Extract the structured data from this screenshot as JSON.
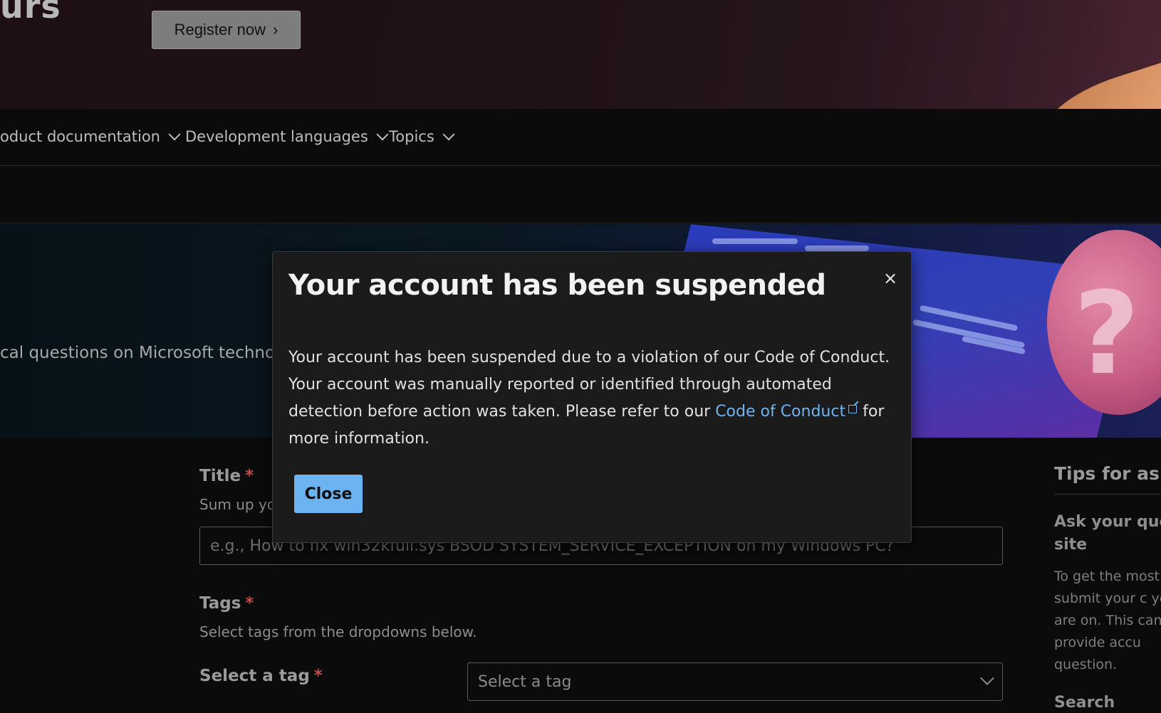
{
  "promo": {
    "title_fragment": "urs",
    "register_label": "Register now",
    "register_chevron": "›"
  },
  "nav": {
    "items": [
      {
        "label": "oduct documentation"
      },
      {
        "label": "Development languages"
      },
      {
        "label": "Topics"
      }
    ]
  },
  "hero": {
    "text_fragment": "cal questions on Microsoft technolog"
  },
  "form": {
    "title_label": "Title",
    "title_help": "Sum up yo",
    "title_placeholder": "e.g., How to fix win32kfull.sys BSOD SYSTEM_SERVICE_EXCEPTION on my Windows PC?",
    "required_marker": "*",
    "tags_label": "Tags",
    "tags_help": "Select tags from the dropdowns below.",
    "select_tag_label": "Select a tag",
    "select_tag_value": "Select a tag"
  },
  "sidebar": {
    "tips_title": "Tips for aski",
    "ask_heading": "Ask your ques site",
    "ask_text": "To get the most to submit your c you are on. This can provide accu question.",
    "search_heading": "Search"
  },
  "modal": {
    "title": "Your account has been suspended",
    "close_x": "×",
    "body_part1": "Your account has been suspended due to a violation of our Code of Conduct. Your account was manually reported or identified through automated detection before action was taken. Please refer to our ",
    "link_text": "Code of Conduct",
    "body_part2": "for more information.",
    "close_button": "Close"
  },
  "colors": {
    "accent": "#6cb4f1",
    "modal_bg": "#1b1b1b",
    "page_bg": "#0b0b0b",
    "required": "#c24a4a"
  }
}
